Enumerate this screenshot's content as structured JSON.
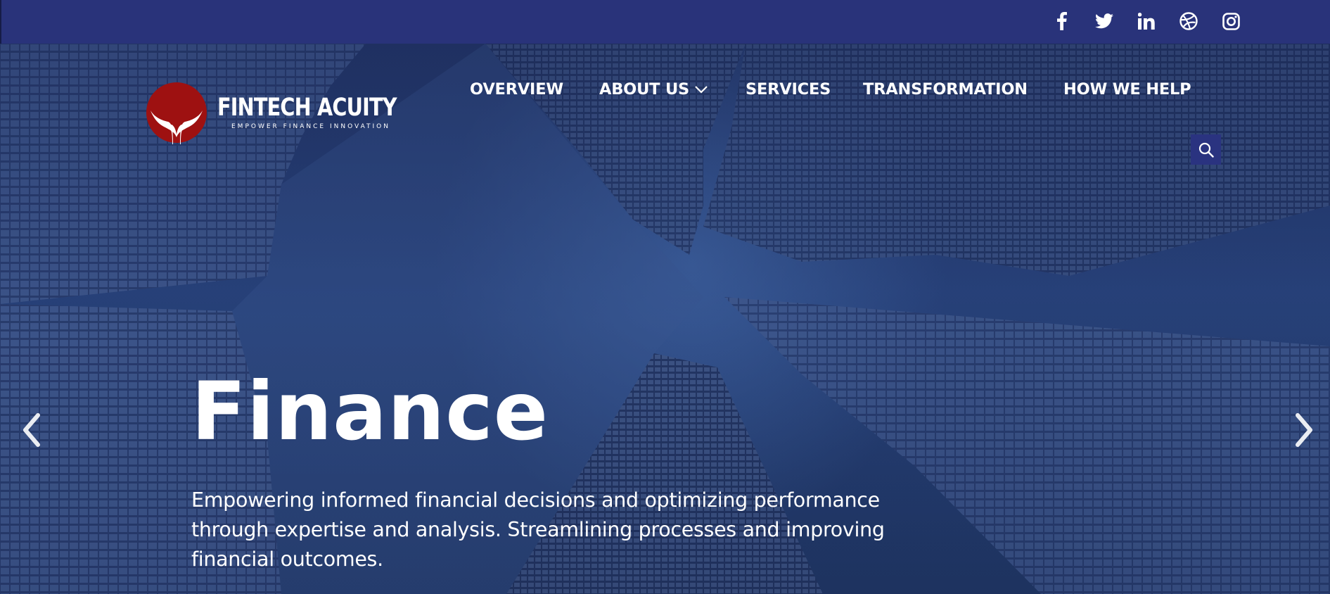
{
  "social": [
    {
      "icon": "facebook-icon"
    },
    {
      "icon": "twitter-icon"
    },
    {
      "icon": "linkedin-icon"
    },
    {
      "icon": "dribbble-icon"
    },
    {
      "icon": "instagram-icon"
    }
  ],
  "brand": {
    "name": "FINTECH ACUITY",
    "tagline": "EMPOWER FINANCE INNOVATION",
    "logo_color": "#9e1111"
  },
  "nav": {
    "items": [
      {
        "label": "OVERVIEW"
      },
      {
        "label": "ABOUT US",
        "has_dropdown": true
      },
      {
        "label": "SERVICES"
      },
      {
        "label": "TRANSFORMATION"
      },
      {
        "label": "HOW WE HELP"
      }
    ],
    "search_icon": "search-icon"
  },
  "hero": {
    "title": "Finance",
    "description": "Empowering informed financial decisions and optimizing performance through expertise and analysis. Streamlining processes and improving financial outcomes.",
    "prev_icon": "chevron-left-icon",
    "next_icon": "chevron-right-icon"
  },
  "colors": {
    "topbar": "#29337a",
    "accent": "#2a3380",
    "hero_overlay": "#1d2d5c",
    "text": "#ffffff"
  }
}
